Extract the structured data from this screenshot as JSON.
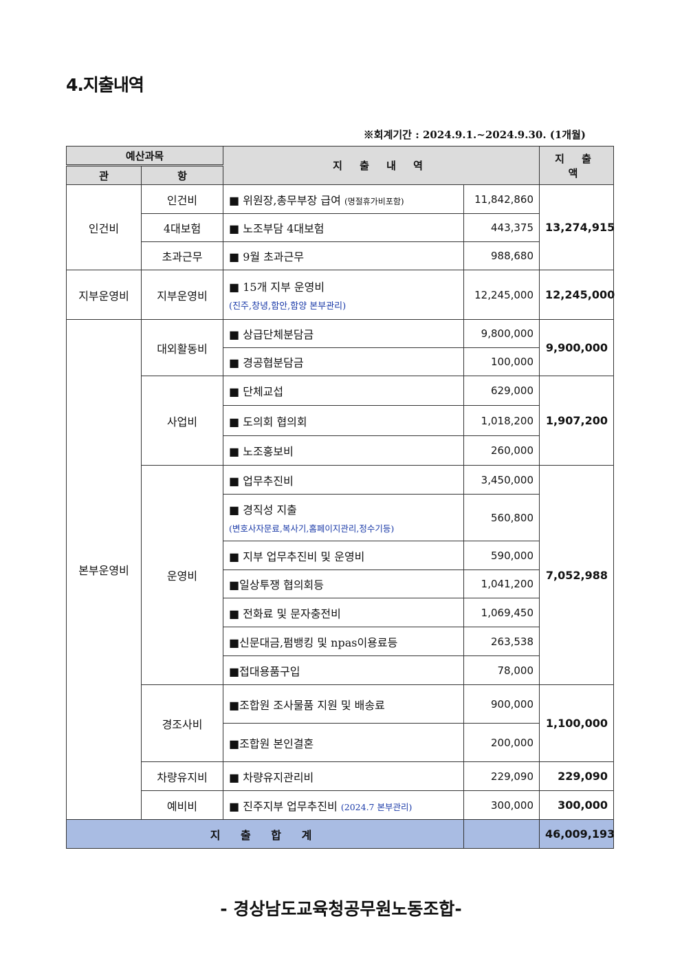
{
  "title": "4.지출내역",
  "period": "※회계기간 : 2024.9.1.~2024.9.30. (1개월)",
  "header": {
    "budget_subject": "예산과목",
    "kwan": "관",
    "hang": "항",
    "details": "지 출 내 역",
    "amount": "지 출 액"
  },
  "rows": [
    {
      "kwan": "인건비",
      "hang": "인건비",
      "desc": "■ 위원장,총무부장 급여",
      "note": "(명절휴가비포함)",
      "amount": "11,842,860",
      "subtotal": "13,274,915"
    },
    {
      "hang": "4대보험",
      "desc": "■ 노조부담 4대보험",
      "amount": "443,375"
    },
    {
      "hang": "초과근무",
      "desc": "■ 9월 초과근무",
      "amount": "988,680"
    },
    {
      "kwan": "지부운영비",
      "hang": "지부운영비",
      "desc": "■ 15개 지부 운영비",
      "note": "(진주,창녕,함안,함양 본부관리)",
      "amount": "12,245,000",
      "subtotal": "12,245,000"
    },
    {
      "kwan": "본부운영비",
      "hang": "대외활동비",
      "desc": "■ 상급단체분담금",
      "amount": "9,800,000",
      "subtotal": "9,900,000"
    },
    {
      "desc": "■ 경공협분담금",
      "amount": "100,000"
    },
    {
      "hang": "사업비",
      "desc": "■ 단체교섭",
      "amount": "629,000",
      "subtotal": "1,907,200"
    },
    {
      "desc": "■ 도의회 협의회",
      "amount": "1,018,200"
    },
    {
      "desc": "■ 노조홍보비",
      "amount": "260,000"
    },
    {
      "hang": "운영비",
      "desc": "■ 업무추진비",
      "amount": "3,450,000",
      "subtotal": "7,052,988"
    },
    {
      "desc": "■ 경직성 지출",
      "note": "(변호사자문료,복사기,홈페이지관리,정수기등)",
      "amount": "560,800"
    },
    {
      "desc": "■ 지부 업무추진비 및 운영비",
      "amount": "590,000"
    },
    {
      "desc": "■일상투쟁 협의회등",
      "amount": "1,041,200"
    },
    {
      "desc": "■ 전화료 및 문자충전비",
      "amount": "1,069,450"
    },
    {
      "desc": "■신문대금,펌뱅킹 및 npas이용료등",
      "amount": "263,538"
    },
    {
      "desc": "■접대용품구입",
      "amount": "78,000"
    },
    {
      "hang": "경조사비",
      "desc": "■조합원 조사물품 지원 및 배송료",
      "amount": "900,000",
      "subtotal": "1,100,000"
    },
    {
      "desc": "■조합원 본인결혼",
      "amount": "200,000"
    },
    {
      "hang": "차량유지비",
      "desc": "■ 차량유지관리비",
      "amount": "229,090",
      "subtotal": "229,090"
    },
    {
      "hang": "예비비",
      "desc": "■ 진주지부 업무추진비",
      "note": "(2024.7 본부관리)",
      "amount": "300,000",
      "subtotal": "300,000"
    }
  ],
  "total": {
    "label": "지 출 합 계",
    "value": "46,009,193"
  },
  "footer": "- 경상남도교육청공무원노동조합-"
}
